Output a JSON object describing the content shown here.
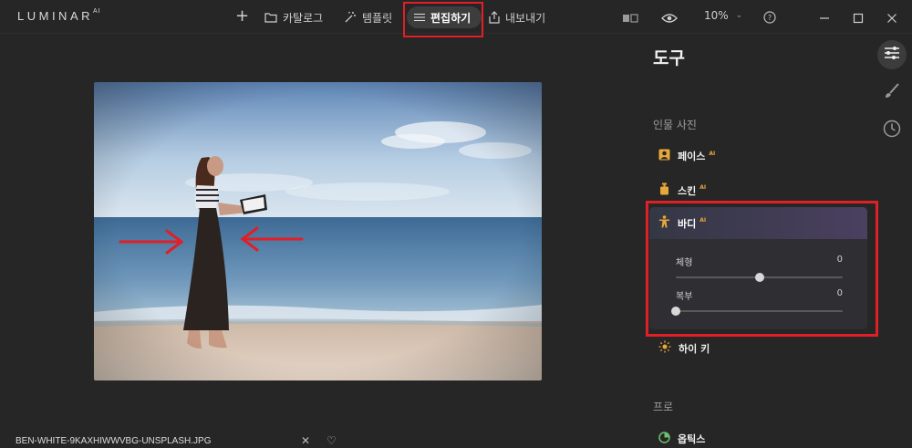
{
  "app": {
    "logo": "LUMINAR",
    "logo_suffix": "AI"
  },
  "nav": {
    "add_label": "+",
    "catalog_label": "카탈로그",
    "templates_label": "템플릿",
    "edit_label": "편집하기",
    "export_label": "내보내기"
  },
  "toolbar": {
    "zoom": "10%"
  },
  "file": {
    "name": "BEN-WHITE-9KAXHIWWVBG-UNSPLASH.JPG"
  },
  "panel": {
    "title": "도구",
    "section_portrait": "인물 사진",
    "section_pro": "프로",
    "tools": {
      "face": {
        "label": "페이스",
        "badge": "AI"
      },
      "skin": {
        "label": "스킨",
        "badge": "AI"
      },
      "body": {
        "label": "바디",
        "badge": "AI"
      },
      "high_key": {
        "label": "하이 키"
      },
      "optics": {
        "label": "옵틱스"
      }
    },
    "body_sliders": [
      {
        "label": "체형",
        "value": "0",
        "position": 0.5
      },
      {
        "label": "복부",
        "value": "0",
        "position": 0.0
      }
    ]
  },
  "colors": {
    "accent": "#e8a73a",
    "annotation": "#e11f26",
    "background": "#262626"
  }
}
